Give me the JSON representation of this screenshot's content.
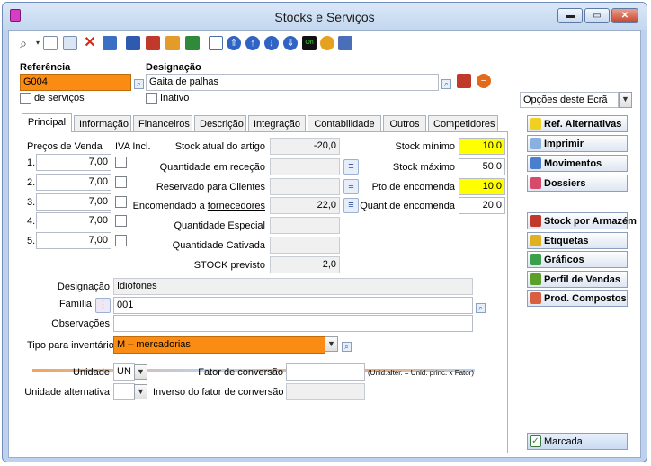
{
  "window": {
    "title": "Stocks e Serviços",
    "min_label": "▬",
    "max_label": "▭",
    "close_label": "✕"
  },
  "toolbar": {
    "icons": [
      "search-icon",
      "new-doc-icon",
      "copy-icon",
      "delete-icon",
      "window-icon",
      "grid-icon",
      "hierarchy-icon",
      "email-icon",
      "refresh-icon",
      "zoom-icon",
      "arrow-up-first-icon",
      "arrow-up-icon",
      "arrow-down-icon",
      "arrow-down-last-icon",
      "on-icon",
      "cycle-icon",
      "calendar-icon"
    ]
  },
  "header": {
    "referencia_label": "Referência",
    "referencia_value": "G004",
    "designacao_label": "Designação",
    "designacao_value": "Gaita de palhas",
    "servicos_label": "de serviços",
    "inativo_label": "Inativo"
  },
  "tabs": [
    "Principal",
    "Informação",
    "Financeiros",
    "Descrição",
    "Integração",
    "Contabilidade",
    "Outros",
    "Competidores"
  ],
  "precos": {
    "header": "Preços de Venda",
    "iva_header": "IVA Incl.",
    "rows": [
      {
        "n": "1.",
        "value": "7,00"
      },
      {
        "n": "2.",
        "value": "7,00"
      },
      {
        "n": "3.",
        "value": "7,00"
      },
      {
        "n": "4.",
        "value": "7,00"
      },
      {
        "n": "5.",
        "value": "7,00"
      }
    ]
  },
  "stock": {
    "atual_label": "Stock atual do artigo",
    "atual_value": "-20,0",
    "rececao_label": "Quantidade em receção",
    "rececao_value": "",
    "reservado_label": "Reservado para Clientes",
    "reservado_value": "",
    "encomendado_label": "Encomendado a",
    "encomendado_link": "fornecedores",
    "encomendado_value": "22,0",
    "especial_label": "Quantidade Especial",
    "especial_value": "",
    "cativada_label": "Quantidade Cativada",
    "cativada_value": "",
    "previsto_label": "STOCK previsto",
    "previsto_value": "2,0"
  },
  "limits": {
    "minimo_label": "Stock mínimo",
    "minimo_value": "10,0",
    "maximo_label": "Stock máximo",
    "maximo_value": "50,0",
    "pto_label": "Pto.de encomenda",
    "pto_value": "10,0",
    "quant_label": "Quant.de encomenda",
    "quant_value": "20,0"
  },
  "details": {
    "designacao_label": "Designação",
    "designacao_value": "Idiofones",
    "familia_label": "Família",
    "familia_value": "001",
    "observacoes_label": "Observações",
    "observacoes_value": "",
    "tipo_label": "Tipo para inventário",
    "tipo_value": "M – mercadorias",
    "unidade_label": "Unidade",
    "unidade_value": "UN",
    "unidade_alt_label": "Unidade alternativa",
    "unidade_alt_value": "",
    "fator_label": "Fator de conversão",
    "fator_value": "",
    "fator_note": "(Unid.alter. = Unid. princ. x Fator)",
    "inverso_label": "Inverso do fator de conversão",
    "inverso_value": ""
  },
  "sidebar": {
    "options_label": "Opções deste Ecrã",
    "buttons_top": [
      "Ref. Alternativas",
      "Imprimir",
      "Movimentos",
      "Dossiers"
    ],
    "buttons_bottom": [
      "Stock por Armazém",
      "Etiquetas",
      "Gráficos",
      "Perfil de Vendas",
      "Prod. Compostos"
    ],
    "marcada_label": "Marcada"
  },
  "colors": {
    "orange": "#fa8c14",
    "yellow": "#ffff00",
    "accent": "#2c4d9a"
  }
}
